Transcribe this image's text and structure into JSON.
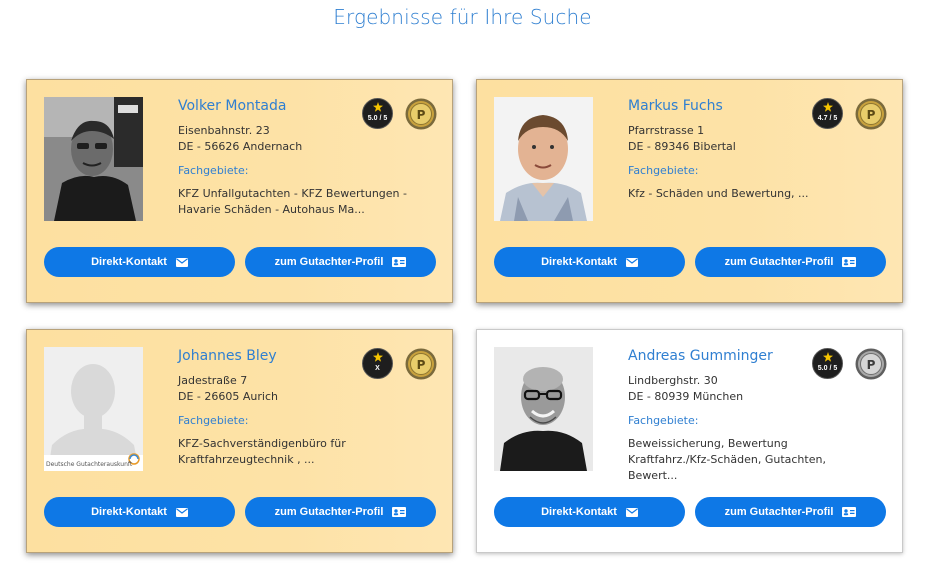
{
  "page": {
    "title": "Ergebnisse für Ihre Suche"
  },
  "labels": {
    "fachgebiete": "Fachgebiete:",
    "kontakt_button": "Direkt-Kontakt",
    "profil_button": "zum Gutachter-Profil",
    "photo_watermark": "Deutsche Gutachterauskunft"
  },
  "colors": {
    "accent": "#2f7fd1",
    "button": "#0e78e6",
    "card_gold": "#fde1a3"
  },
  "icons": {
    "contact": "envelope-icon",
    "profile": "id-card-icon",
    "rating": "star-icon",
    "premium": "premium-p-icon"
  },
  "experts": [
    {
      "name": "Volker Montada",
      "street": "Eisenbahnstr. 23",
      "city": "DE - 56626 Andernach",
      "fachgebiete": "KFZ Unfallgutachten - KFZ Bewertungen - Havarie Schäden - Autohaus Ma...",
      "rating": "5.0 / 5",
      "premium": "gold"
    },
    {
      "name": "Markus Fuchs",
      "street": "Pfarrstrasse 1",
      "city": "DE - 89346 Bibertal",
      "fachgebiete": "Kfz - Schäden und Bewertung, ...",
      "rating": "4.7 / 5",
      "premium": "gold"
    },
    {
      "name": "Johannes Bley",
      "street": "Jadestraße 7",
      "city": "DE - 26605 Aurich",
      "fachgebiete": "KFZ-Sachverständigenbüro für Kraftfahrzeugtechnik , ...",
      "rating": "X",
      "premium": "gold"
    },
    {
      "name": "Andreas Gumminger",
      "street": "Lindberghstr. 30",
      "city": "DE - 80939 München",
      "fachgebiete": "Beweissicherung, Bewertung Kraftfahrz./Kfz-Schäden, Gutachten, Bewert...",
      "rating": "5.0 / 5",
      "premium": "silver"
    }
  ]
}
